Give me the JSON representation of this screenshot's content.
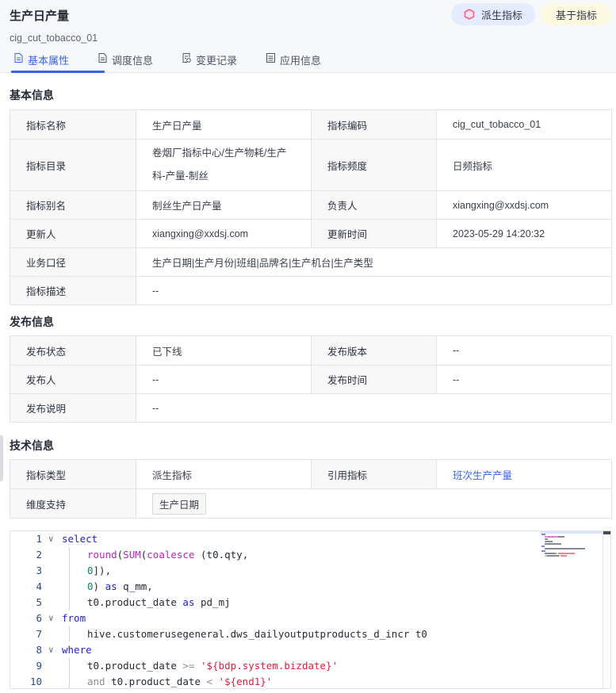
{
  "header": {
    "title": "生产日产量",
    "code": "cig_cut_tobacco_01",
    "badges": [
      {
        "label": "派生指标",
        "icon": "hexagon-icon",
        "bg": "#e5ecfd",
        "icon_color": "#f06292"
      },
      {
        "label": "基于指标",
        "bg": "#fcf9e1"
      }
    ],
    "tabs": [
      {
        "label": "基本属性",
        "icon": "document-icon",
        "active": true
      },
      {
        "label": "调度信息",
        "icon": "document-icon",
        "active": false
      },
      {
        "label": "变更记录",
        "icon": "record-icon",
        "active": false
      },
      {
        "label": "应用信息",
        "icon": "list-icon",
        "active": false
      }
    ]
  },
  "accent_color": "#3a64e8",
  "basic_info": {
    "title": "基本信息",
    "rows": [
      [
        {
          "label": "指标名称",
          "value": "生产日产量"
        },
        {
          "label": "指标编码",
          "value": "cig_cut_tobacco_01"
        }
      ],
      [
        {
          "label": "指标目录",
          "value_lines": [
            "卷烟厂指标中心/生产物耗/生产",
            "科-产量-制丝"
          ]
        },
        {
          "label": "指标频度",
          "value": "日频指标"
        }
      ],
      [
        {
          "label": "指标别名",
          "value": "制丝生产日产量"
        },
        {
          "label": "负责人",
          "value": "xiangxing@xxdsj.com"
        }
      ],
      [
        {
          "label": "更新人",
          "value": "xiangxing@xxdsj.com"
        },
        {
          "label": "更新时间",
          "value": "2023-05-29 14:20:32"
        }
      ],
      [
        {
          "label": "业务口径",
          "value": "生产日期|生产月份|班组|品牌名|生产机台|生产类型"
        }
      ],
      [
        {
          "label": "指标描述",
          "value": "--"
        }
      ]
    ]
  },
  "publish_info": {
    "title": "发布信息",
    "rows": [
      [
        {
          "label": "发布状态",
          "value": "已下线"
        },
        {
          "label": "发布版本",
          "value": "--"
        }
      ],
      [
        {
          "label": "发布人",
          "value": "--"
        },
        {
          "label": "发布时间",
          "value": "--"
        }
      ],
      [
        {
          "label": "发布说明",
          "value": "--"
        }
      ]
    ]
  },
  "tech_info": {
    "title": "技术信息",
    "rows": [
      [
        {
          "label": "指标类型",
          "value": "派生指标"
        },
        {
          "label": "引用指标",
          "value": "班次生产产量",
          "is_link": true
        }
      ],
      [
        {
          "label": "维度支持",
          "tags": [
            "生产日期"
          ]
        }
      ]
    ]
  },
  "sql_editor": {
    "lines": [
      {
        "n": "1",
        "fold": true,
        "indent": 0,
        "tokens": [
          [
            "kw",
            "select"
          ]
        ]
      },
      {
        "n": "2",
        "fold": false,
        "indent": 1,
        "tokens": [
          [
            "fn",
            "round"
          ],
          [
            "plain",
            "("
          ],
          [
            "fn",
            "SUM"
          ],
          [
            "plain",
            "("
          ],
          [
            "fn",
            "coalesce"
          ],
          [
            "plain",
            " (t0.qty,"
          ]
        ]
      },
      {
        "n": "3",
        "fold": false,
        "indent": 1,
        "tokens": [
          [
            "num",
            "0"
          ],
          [
            "plain",
            "]),"
          ]
        ]
      },
      {
        "n": "4",
        "fold": false,
        "indent": 1,
        "tokens": [
          [
            "num",
            "0"
          ],
          [
            "plain",
            ") "
          ],
          [
            "kw",
            "as"
          ],
          [
            "plain",
            " q_mm,"
          ]
        ]
      },
      {
        "n": "5",
        "fold": false,
        "indent": 1,
        "tokens": [
          [
            "plain",
            "t0.product_date "
          ],
          [
            "kw",
            "as"
          ],
          [
            "plain",
            " pd_mj"
          ]
        ]
      },
      {
        "n": "6",
        "fold": true,
        "indent": 0,
        "tokens": [
          [
            "kw",
            "from"
          ]
        ]
      },
      {
        "n": "7",
        "fold": false,
        "indent": 1,
        "tokens": [
          [
            "plain",
            "hive.customerusegeneral.dws_dailyoutputproducts_d_incr t0"
          ]
        ]
      },
      {
        "n": "8",
        "fold": true,
        "indent": 0,
        "tokens": [
          [
            "kw",
            "where"
          ]
        ]
      },
      {
        "n": "9",
        "fold": false,
        "indent": 1,
        "tokens": [
          [
            "plain",
            "t0.product_date "
          ],
          [
            "op",
            ">="
          ],
          [
            "plain",
            " "
          ],
          [
            "str",
            "'${bdp.system.bizdate}'"
          ]
        ]
      },
      {
        "n": "10",
        "fold": false,
        "indent": 1,
        "tokens": [
          [
            "op",
            "and"
          ],
          [
            "plain",
            " t0.product_date "
          ],
          [
            "op",
            "<"
          ],
          [
            "plain",
            " "
          ],
          [
            "str",
            "'${end1}'"
          ]
        ]
      }
    ]
  }
}
